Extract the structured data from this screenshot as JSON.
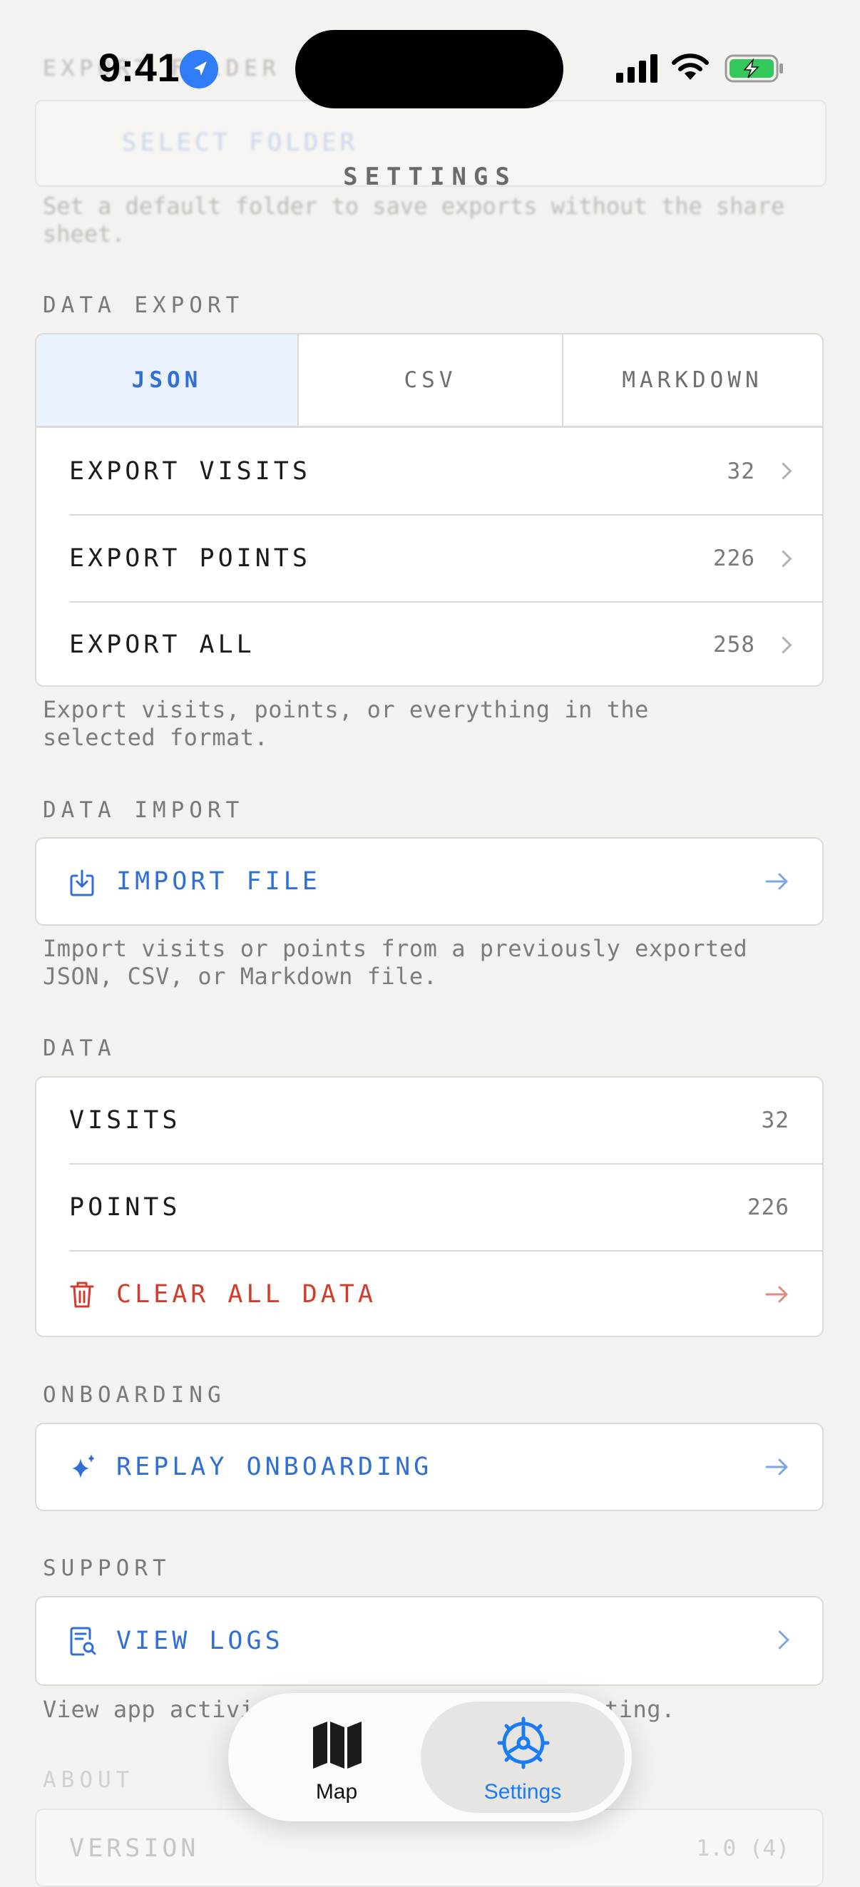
{
  "status_bar": {
    "time": "9:41"
  },
  "background": {
    "export_folder_label": "EXPORT FOLDER",
    "select_folder": "SELECT FOLDER",
    "export_folder_help": "Set a default folder to save exports without the share sheet."
  },
  "header": {
    "title": "SETTINGS"
  },
  "data_export": {
    "label": "DATA EXPORT",
    "formats": [
      "JSON",
      "CSV",
      "MARKDOWN"
    ],
    "selected_format": "JSON",
    "rows": [
      {
        "label": "EXPORT VISITS",
        "count": "32"
      },
      {
        "label": "EXPORT POINTS",
        "count": "226"
      },
      {
        "label": "EXPORT ALL",
        "count": "258"
      }
    ],
    "help_line1": "Export visits, points, or everything in the",
    "help_line2": "selected format."
  },
  "data_import": {
    "label": "DATA IMPORT",
    "button": "IMPORT FILE",
    "help_line1": "Import visits or points from a previously exported",
    "help_line2": "JSON, CSV, or Markdown file."
  },
  "data": {
    "label": "DATA",
    "visits_label": "VISITS",
    "visits_count": "32",
    "points_label": "POINTS",
    "points_count": "226",
    "clear_button": "CLEAR ALL DATA"
  },
  "onboarding": {
    "label": "ONBOARDING",
    "button": "REPLAY ONBOARDING"
  },
  "support": {
    "label": "SUPPORT",
    "button": "VIEW LOGS",
    "help_left": "View app activi",
    "help_right": "ting."
  },
  "about": {
    "label": "ABOUT",
    "version_label": "VERSION",
    "version_value": "1.0 (4)"
  },
  "tab_bar": {
    "tabs": [
      {
        "label": "Map"
      },
      {
        "label": "Settings"
      }
    ],
    "selected": "Settings"
  },
  "colors": {
    "accent": "#2f6fd6",
    "destructive": "#d33b2c",
    "background": "#f3f2ef"
  }
}
